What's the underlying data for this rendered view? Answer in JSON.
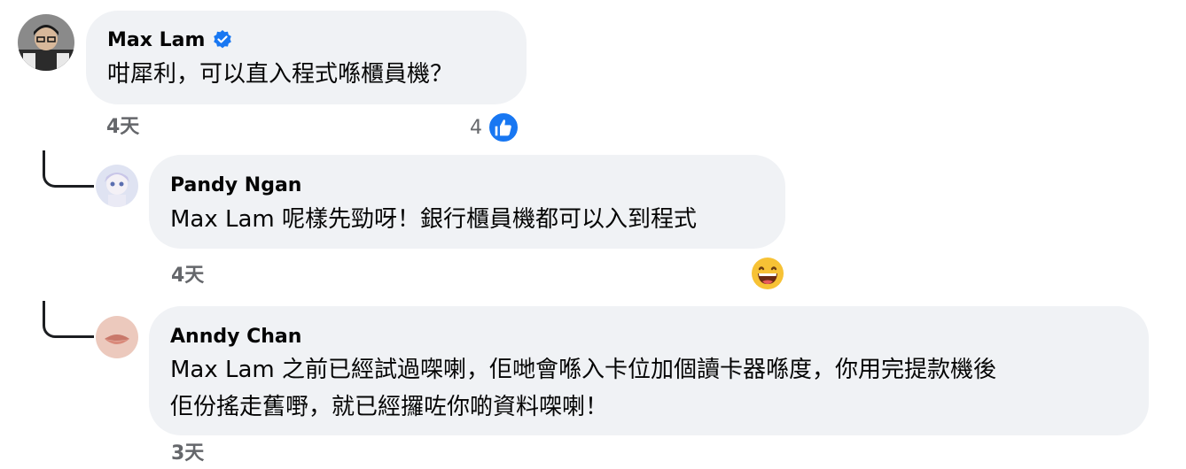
{
  "comments": [
    {
      "author": "Max Lam",
      "verified": true,
      "text": "咁犀利，可以直入程式喺櫃員機？",
      "time": "4天",
      "reaction_count": "4",
      "reaction_icon": "like-icon"
    },
    {
      "author": "Pandy Ngan",
      "text": "Max Lam 呢樣先勁呀！銀行櫃員機都可以入到程式",
      "time": "4天",
      "reaction_icon": "grinning-emoji-icon"
    },
    {
      "author": "Anndy Chan",
      "text_lines": [
        "Max Lam 之前已經試過㗎喇，佢哋會喺入卡位加個讀卡器喺度，你用完提款機後",
        "佢份搖走舊嘢，就已經攞咗你啲資料㗎喇！"
      ],
      "time": "3天"
    }
  ],
  "colors": {
    "bubble": "#f0f2f5",
    "meta_text": "#65676b",
    "verified_blue": "#1877f2",
    "like_blue": "#1877f2"
  }
}
